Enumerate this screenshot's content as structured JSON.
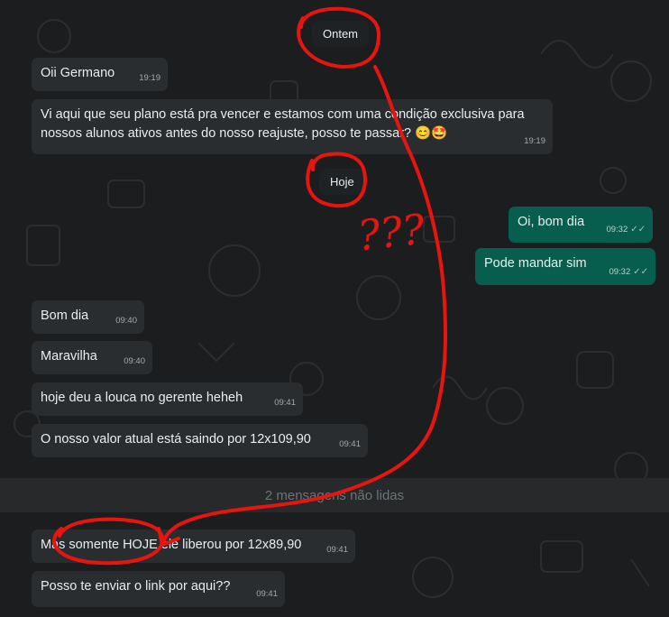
{
  "chat": {
    "dividers": {
      "yesterday": "Ontem",
      "today": "Hoje"
    },
    "unread_banner": "2 mensagens não lidas",
    "messages": [
      {
        "text": "Oii Germano",
        "time": "19:19"
      },
      {
        "text": "Vi aqui que seu plano está pra vencer e estamos com uma condição exclusiva para",
        "text2": "nossos alunos ativos antes do nosso reajuste, posso te passar? 😊🤩",
        "time": "19:19"
      },
      {
        "text": "Oi, bom dia",
        "time": "09:32"
      },
      {
        "text": "Pode mandar sim",
        "time": "09:32"
      },
      {
        "text": "Bom dia",
        "time": "09:40"
      },
      {
        "text": "Maravilha",
        "time": "09:40"
      },
      {
        "text": "hoje deu a louca no gerente heheh",
        "time": "09:41"
      },
      {
        "text": "O nosso valor atual está saindo por 12x109,90",
        "time": "09:41"
      },
      {
        "text": "Mas somente HOJE ele liberou por 12x89,90",
        "time": "09:41"
      },
      {
        "text": "Posso te enviar o link por aqui??",
        "time": "09:41"
      }
    ],
    "read_ticks": "✓✓"
  },
  "annotations": {
    "handwritten": "???"
  },
  "colors": {
    "annotation": "#e8140f",
    "outgoing_bubble": "#075e4f",
    "incoming_bubble": "#2a2d2f"
  }
}
